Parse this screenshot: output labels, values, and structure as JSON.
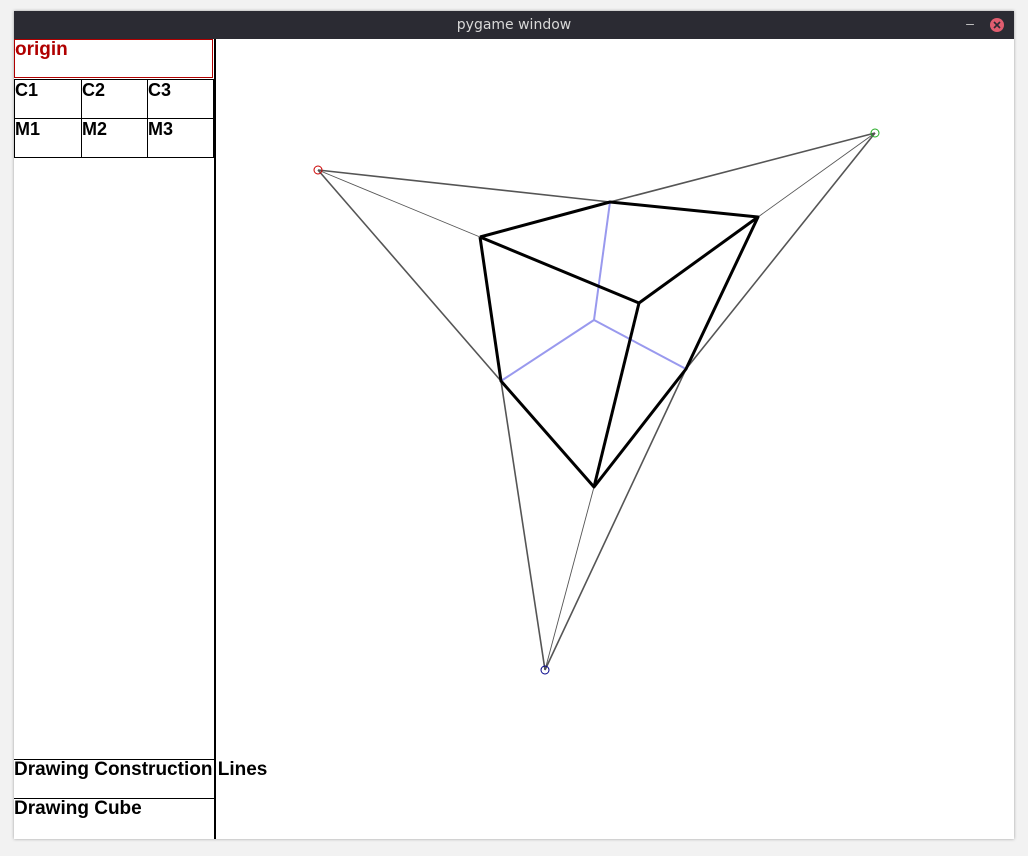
{
  "window": {
    "title": "pygame window",
    "minimize_glyph": "–",
    "close_icon": "close-icon"
  },
  "sidebar": {
    "origin_label": "origin",
    "cells": [
      {
        "label": "C1"
      },
      {
        "label": "C2"
      },
      {
        "label": "C3"
      },
      {
        "label": "M1"
      },
      {
        "label": "M2"
      },
      {
        "label": "M3"
      }
    ],
    "status": {
      "construction_lines": "Drawing Construction Lines",
      "cube": "Drawing Cube"
    }
  },
  "colors": {
    "origin": "#b00000",
    "vanishing_point_1": "#cc0000",
    "vanishing_point_2": "#22aa22",
    "vanishing_point_3": "#000088",
    "hidden_edges": "#9999ee",
    "construction_lines": "#555555",
    "cube_edges": "#000000"
  }
}
